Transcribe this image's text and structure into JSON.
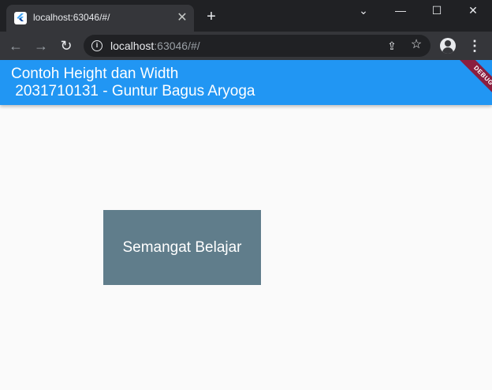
{
  "tab": {
    "title": "localhost:63046/#/",
    "close_glyph": "✕"
  },
  "toolbar": {
    "new_tab_glyph": "+",
    "back_glyph": "←",
    "forward_glyph": "→",
    "reload_glyph": "↻",
    "url_host": "localhost",
    "url_rest": ":63046/#/",
    "share_glyph": "⇪",
    "star_glyph": "☆",
    "menu_glyph": "⋮",
    "info_glyph": "i"
  },
  "window_controls": {
    "chevron": "⌄",
    "minimize": "—",
    "maximize": "☐",
    "close": "✕"
  },
  "app": {
    "appbar_title": "Contoh Height dan Width\n 2031710131 - Guntur Bagus Aryoga",
    "debug_banner": "DEBUG",
    "card_text": "Semangat Belajar"
  },
  "colors": {
    "appbar": "#2196f3",
    "card": "#607d8b",
    "debug_banner": "#8b1e3f",
    "page_background": "#fafafa",
    "browser_frame": "#202124",
    "toolbar": "#35363a"
  },
  "icons": [
    "flutter-favicon-icon",
    "close-icon",
    "plus-icon",
    "back-arrow-icon",
    "forward-arrow-icon",
    "reload-icon",
    "info-icon",
    "share-icon",
    "star-icon",
    "profile-icon",
    "kebab-menu-icon"
  ]
}
